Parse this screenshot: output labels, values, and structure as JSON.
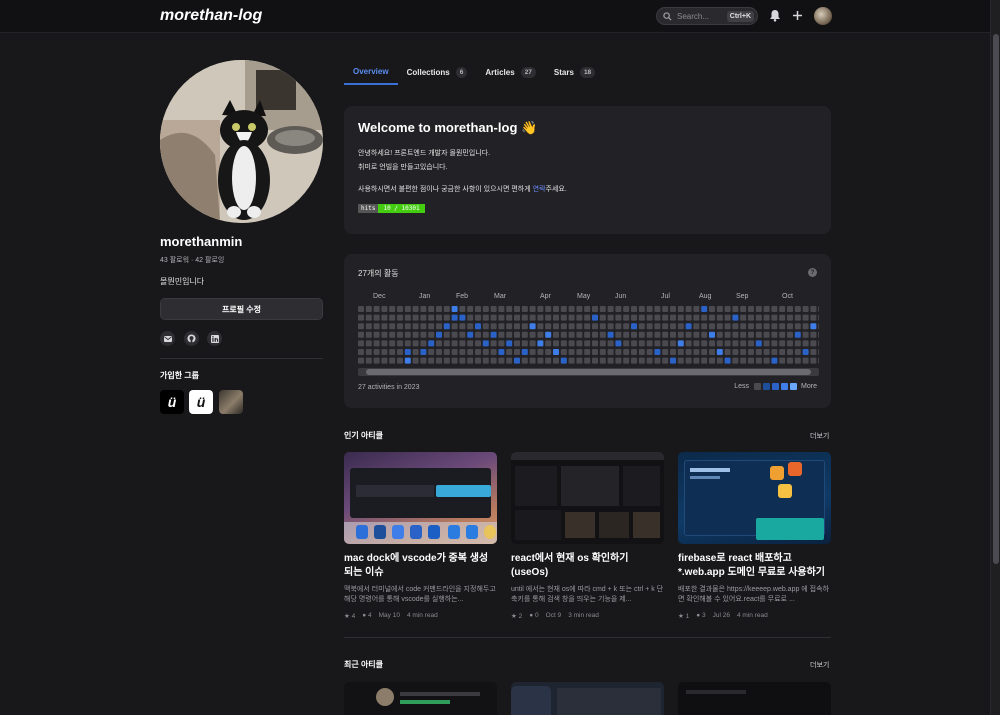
{
  "header": {
    "logo": "morethan-log",
    "search_placeholder": "Search...",
    "search_shortcut": "Ctrl+K"
  },
  "profile": {
    "name": "morethanmin",
    "follow": "43 팔로워 · 42 팔로잉",
    "bio": "몰뭔민입니다",
    "edit_label": "프로필 수정",
    "groups_title": "가입한 그룹",
    "groups": [
      "ü",
      "ü"
    ]
  },
  "tabs": [
    {
      "label": "Overview"
    },
    {
      "label": "Collections",
      "count": "6"
    },
    {
      "label": "Articles",
      "count": "27"
    },
    {
      "label": "Stars",
      "count": "18"
    }
  ],
  "welcome": {
    "title": "Welcome to morethan-log 👋",
    "line1": "안녕하세요! 프론트엔드 개발자 몰뭔민입니다.",
    "line2": "취미로 언빌을 만들고있습니다.",
    "line3_before": "사용하시면서 불편한 점이나 궁금한 사항이 있으시면 편하게 ",
    "line3_link": "연락",
    "line3_after": "주세요.",
    "hits_label": "hits",
    "hits_value": "10 / 10301"
  },
  "activity": {
    "title": "27개의 활동",
    "months": [
      "Dec",
      "Jan",
      "Feb",
      "Mar",
      "Apr",
      "May",
      "Jun",
      "Jul",
      "Aug",
      "Sep",
      "Oct"
    ],
    "footer": "27 activities in 2023",
    "legend_less": "Less",
    "legend_more": "More",
    "colors": {
      "empty": "#4a4a50",
      "level1": "#1d4f9b",
      "level2": "#2a62c8",
      "level3": "#3f7ee8",
      "level4": "#6ba6ff"
    }
  },
  "popular": {
    "title": "인기 아티클",
    "more": "더보기",
    "articles": [
      {
        "title": "mac dock에 vscode가 중복 생성되는 이슈",
        "desc": "맥북에서 터미널에서 code 커맨드라인을 지정해두고 해당 명령어를 통해 vscode를 실행하는...",
        "stars": "4",
        "comments": "4",
        "date": "May 10",
        "read": "4 min read"
      },
      {
        "title": "react에서 현재 os 확인하기 (useOs)",
        "desc": "until 에서는 현재 os에 따라 cmd + k 또는 ctrl + k 단축키를 통해 검색 창을 띄우는 기능을 제...",
        "stars": "2",
        "comments": "0",
        "date": "Oct 9",
        "read": "3 min read"
      },
      {
        "title": "firebase로 react 배포하고 *.web.app 도메인 무료로 사용하기",
        "desc": "배포한 결과물은 https://keeeep.web.app 에 접속하면 확인해볼 수 있어요.react를 무료로 ...",
        "stars": "1",
        "comments": "3",
        "date": "Jul 26",
        "read": "4 min read"
      }
    ]
  },
  "recent": {
    "title": "최근 아티클",
    "more": "더보기"
  }
}
